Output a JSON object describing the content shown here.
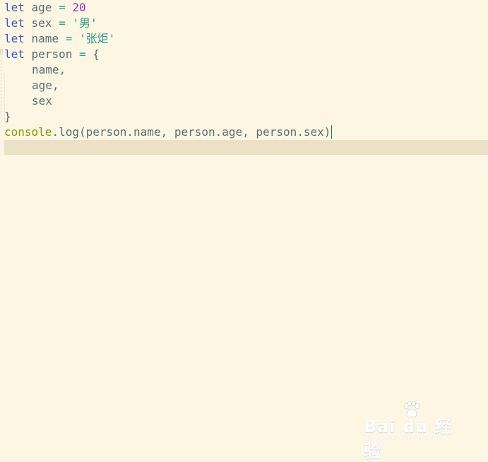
{
  "editor": {
    "lines": [
      {
        "tokens": [
          {
            "t": "let",
            "c": "kw"
          },
          {
            "t": " age ",
            "c": "var"
          },
          {
            "t": "=",
            "c": "op"
          },
          {
            "t": " ",
            "c": "var"
          },
          {
            "t": "20",
            "c": "num"
          }
        ]
      },
      {
        "tokens": [
          {
            "t": "let",
            "c": "kw"
          },
          {
            "t": " sex ",
            "c": "var"
          },
          {
            "t": "=",
            "c": "op"
          },
          {
            "t": " ",
            "c": "var"
          },
          {
            "t": "'男'",
            "c": "str"
          }
        ]
      },
      {
        "tokens": [
          {
            "t": "let",
            "c": "kw"
          },
          {
            "t": " name ",
            "c": "var"
          },
          {
            "t": "=",
            "c": "op"
          },
          {
            "t": " ",
            "c": "var"
          },
          {
            "t": "'张炬'",
            "c": "str"
          }
        ]
      },
      {
        "tokens": [
          {
            "t": "let",
            "c": "kw"
          },
          {
            "t": " person ",
            "c": "var"
          },
          {
            "t": "=",
            "c": "op"
          },
          {
            "t": " {",
            "c": "punc"
          }
        ]
      },
      {
        "indent": 1,
        "tokens": [
          {
            "t": "name,",
            "c": "var"
          }
        ]
      },
      {
        "indent": 1,
        "tokens": [
          {
            "t": "age,",
            "c": "var"
          }
        ]
      },
      {
        "indent": 1,
        "tokens": [
          {
            "t": "sex",
            "c": "var"
          }
        ]
      },
      {
        "tokens": [
          {
            "t": "}",
            "c": "punc"
          }
        ]
      },
      {
        "cursor": true,
        "tokens": [
          {
            "t": "console",
            "c": "console"
          },
          {
            "t": ".",
            "c": "punc"
          },
          {
            "t": "log(person.name, person.age, person.sex)",
            "c": "method"
          }
        ]
      }
    ]
  },
  "watermark": {
    "brand": "Bai du 经验",
    "url": "jingyan.baidu.com"
  },
  "colors": {
    "background": "#fdf6e3",
    "active_line": "#ebe2c6",
    "keyword": "#3a55c2",
    "number": "#9b2ed3",
    "string": "#2a9a8c",
    "console": "#859900",
    "caret": "#1f8a2f"
  }
}
